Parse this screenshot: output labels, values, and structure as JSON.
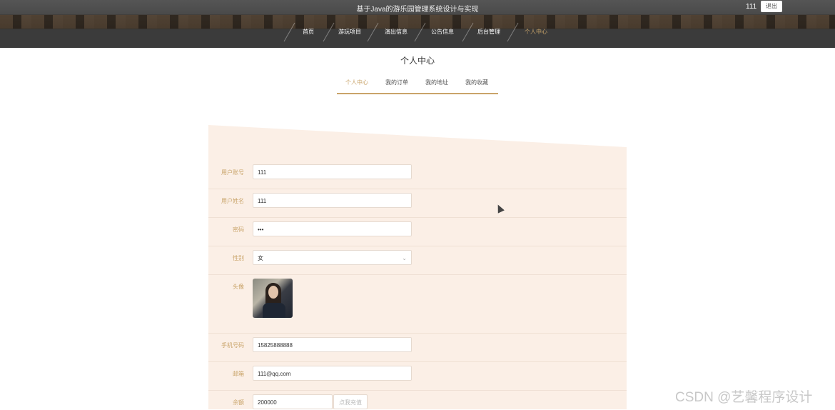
{
  "header": {
    "site_title": "基于Java的游乐园管理系统设计与实现",
    "user_name": "111",
    "logout_label": "退出",
    "nav": [
      "首页",
      "游玩项目",
      "演出信息",
      "公告信息",
      "后台管理",
      "个人中心"
    ]
  },
  "page": {
    "title": "个人中心",
    "tabs": [
      "个人中心",
      "我的订单",
      "我的地址",
      "我的收藏"
    ]
  },
  "form": {
    "account_label": "用户账号",
    "account_value": "111",
    "name_label": "用户姓名",
    "name_value": "111",
    "password_label": "密码",
    "password_value": "•••",
    "gender_label": "性别",
    "gender_value": "女",
    "avatar_label": "头像",
    "phone_label": "手机号码",
    "phone_value": "15825888888",
    "email_label": "邮箱",
    "email_value": "111@qq.com",
    "balance_label": "余额",
    "balance_value": "200000",
    "recharge_label": "点我充值"
  },
  "watermark": "CSDN @艺馨程序设计",
  "colors": {
    "accent": "#c9a46a",
    "panel": "#fbefe6"
  }
}
